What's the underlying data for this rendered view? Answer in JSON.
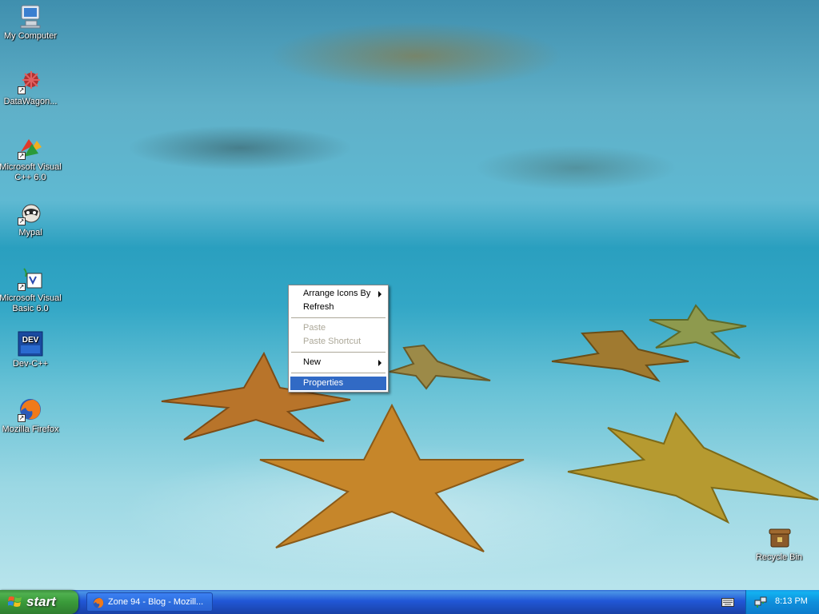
{
  "desktop": {
    "icons": [
      {
        "label": "My Computer",
        "icon": "my-computer-icon"
      },
      {
        "label": "DataWagon...",
        "icon": "datawagon-icon"
      },
      {
        "label": "Microsoft Visual C++ 6.0",
        "icon": "visual-cpp-icon"
      },
      {
        "label": "Mypal",
        "icon": "mypal-icon"
      },
      {
        "label": "Microsoft Visual Basic 6.0",
        "icon": "visual-basic-icon"
      },
      {
        "label": "Dev-C++",
        "icon": "devcpp-icon",
        "badge": "DEV"
      },
      {
        "label": "Mozilla Firefox",
        "icon": "firefox-icon"
      },
      {
        "label": "Recycle Bin",
        "icon": "recycle-bin-icon"
      }
    ]
  },
  "context_menu": {
    "items": [
      {
        "label": "Arrange Icons By",
        "submenu": true,
        "disabled": false
      },
      {
        "label": "Refresh",
        "submenu": false,
        "disabled": false
      },
      {
        "label": "Paste",
        "submenu": false,
        "disabled": true
      },
      {
        "label": "Paste Shortcut",
        "submenu": false,
        "disabled": true
      },
      {
        "label": "New",
        "submenu": true,
        "disabled": false
      },
      {
        "label": "Properties",
        "submenu": false,
        "disabled": false,
        "selected": true
      }
    ]
  },
  "taskbar": {
    "start_label": "start",
    "tasks": [
      {
        "label": "Zone 94 - Blog - Mozill...",
        "icon": "firefox-icon"
      }
    ],
    "tray": {
      "clock": "8:13 PM",
      "icons": [
        "keyboard-icon",
        "network-icon"
      ]
    }
  },
  "colors": {
    "taskbar_blue": "#2157d7",
    "start_green": "#3a9b3a",
    "menu_highlight": "#316ac5",
    "tray_blue": "#0f8fdc"
  }
}
